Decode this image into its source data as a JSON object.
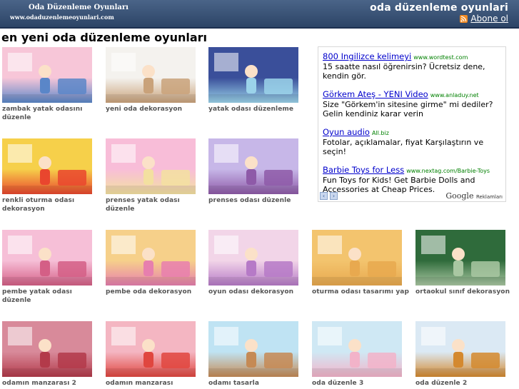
{
  "header": {
    "logo_title": "Oda Düzenleme Oyunları",
    "logo_url": "www.odaduzenlemeoyunlari.com",
    "site_title": "oda düzenleme oyunlari",
    "subscribe_label": "Abone ol"
  },
  "main": {
    "heading": "en yeni oda düzenleme oyunları",
    "games": [
      {
        "title": "zambak yatak odasını düzenle",
        "c1": "#f7c6d8",
        "c2": "#5a86c8"
      },
      {
        "title": "yeni oda dekorasyon",
        "c1": "#f4f2ee",
        "c2": "#c9a27a"
      },
      {
        "title": "yatak odası düzenleme",
        "c1": "#3a4f9a",
        "c2": "#9bd3ea"
      },
      {
        "title": "renkli oturma odası dekorasyon",
        "c1": "#f6d04a",
        "c2": "#e9462e"
      },
      {
        "title": "prenses yatak odası düzenle",
        "c1": "#f8bdd8",
        "c2": "#f3e0a0"
      },
      {
        "title": "prenses odası düzenle",
        "c1": "#c7b7e8",
        "c2": "#8e5aa8"
      },
      {
        "title": "pembe yatak odası düzenle",
        "c1": "#f6bfd7",
        "c2": "#d45f86"
      },
      {
        "title": "pembe oda dekorasyon",
        "c1": "#f6d08a",
        "c2": "#e77fae"
      },
      {
        "title": "oyun odası dekorasyon",
        "c1": "#f2d5e8",
        "c2": "#b67ac7"
      },
      {
        "title": "oturma odası tasarımı yap",
        "c1": "#f3c46e",
        "c2": "#e8a94f"
      },
      {
        "title": "ortaokul sınıf dekorasyon",
        "c1": "#2f6b3b",
        "c2": "#a9c7a2"
      },
      {
        "title": "odamın manzarası 2",
        "c1": "#d88a9a",
        "c2": "#b33a4a"
      },
      {
        "title": "odamın manzarası",
        "c1": "#f4b6c2",
        "c2": "#e0463f"
      },
      {
        "title": "odamı tasarla",
        "c1": "#bfe3f3",
        "c2": "#c58a55"
      },
      {
        "title": "oda düzenle 3",
        "c1": "#cfe8f4",
        "c2": "#f2b3c9"
      },
      {
        "title": "oda düzenle 2",
        "c1": "#dbe9f4",
        "c2": "#d4892f"
      }
    ]
  },
  "ads": {
    "items": [
      {
        "title": "800 Ingilizce kelimeyi",
        "domain": "www.wordtest.com",
        "text": "15 saatte nasıl öğrenirsin? Ücretsiz dene, kendin gör."
      },
      {
        "title": "Görkem Ateş - YENI Video",
        "domain": "www.anladuy.net",
        "text": "Size \"Görkem'in sitesine girme\" mi dediler? Gelin kendiniz karar verin"
      },
      {
        "title": "Oyun audio",
        "domain": "All.biz",
        "text": "Fotolar, açıklamalar, fiyat Karşılaştırın ve seçin!"
      },
      {
        "title": "Barbie Toys for Less",
        "domain": "www.nextag.com/Barbie-Toys",
        "text": "Fun Toys for Kids! Get Barbie Dolls and Accessories at Cheap Prices."
      }
    ],
    "prev_arrow": "‹",
    "next_arrow": "›",
    "google_brand": "Google",
    "google_label": "Reklamları"
  }
}
